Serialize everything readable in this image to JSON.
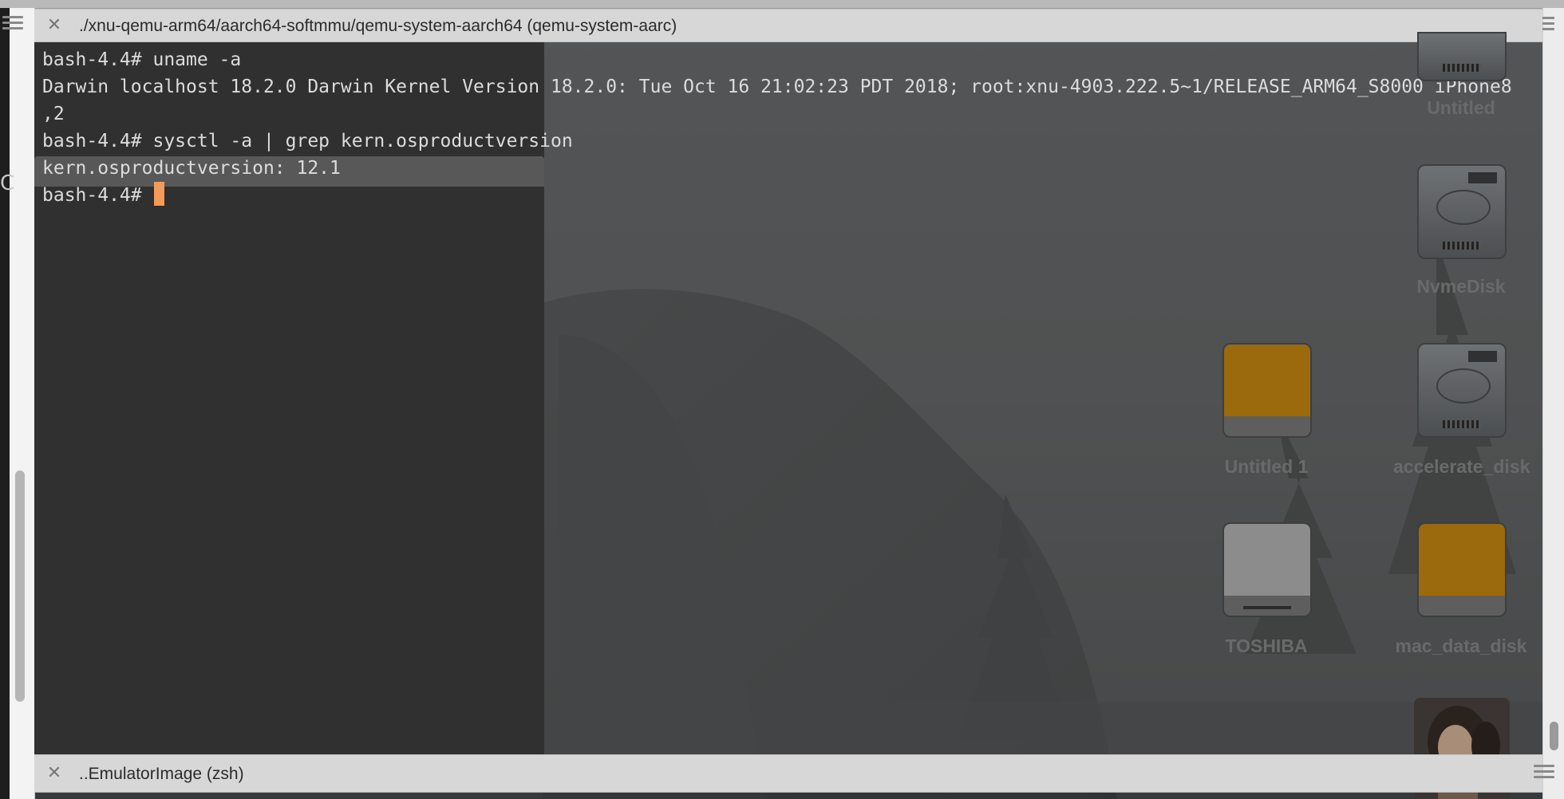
{
  "panes": {
    "top": {
      "title": "./xnu-qemu-arm64/aarch64-softmmu/qemu-system-aarch64 (qemu-system-aarc)"
    },
    "bottom": {
      "title": "..EmulatorImage (zsh)"
    }
  },
  "left_gutter": {
    "ghost_text": "C"
  },
  "terminal": {
    "lines": [
      "bash-4.4# uname -a",
      "Darwin localhost 18.2.0 Darwin Kernel Version 18.2.0: Tue Oct 16 21:02:23 PDT 2018; root:xnu-4903.222.5~1/RELEASE_ARM64_S8000 iPhone8",
      ",2",
      "bash-4.4# sysctl -a | grep kern.osproductversion",
      "kern.osproductversion: 12.1",
      "bash-4.4# "
    ],
    "cursor_color": "#f59b5a"
  },
  "desktop": {
    "icons": [
      {
        "label": "Untitled",
        "kind": "hdd-icon"
      },
      {
        "label": "NvmeDisk",
        "kind": "hdd-icon"
      },
      {
        "label": "Untitled 1",
        "kind": "external-drive-icon",
        "color": "#9a6a0c"
      },
      {
        "label": "accelerate_disk",
        "kind": "hdd-icon"
      },
      {
        "label": "TOSHIBA",
        "kind": "external-drive-icon",
        "color": "#8c8c8c"
      },
      {
        "label": "mac_data_disk",
        "kind": "external-drive-icon",
        "color": "#9a6a0c"
      }
    ]
  },
  "colors": {
    "terminal_text": "#dcdcdc",
    "pane_bar": "#d7d7d7",
    "icon_label": "#6a6a6a"
  }
}
